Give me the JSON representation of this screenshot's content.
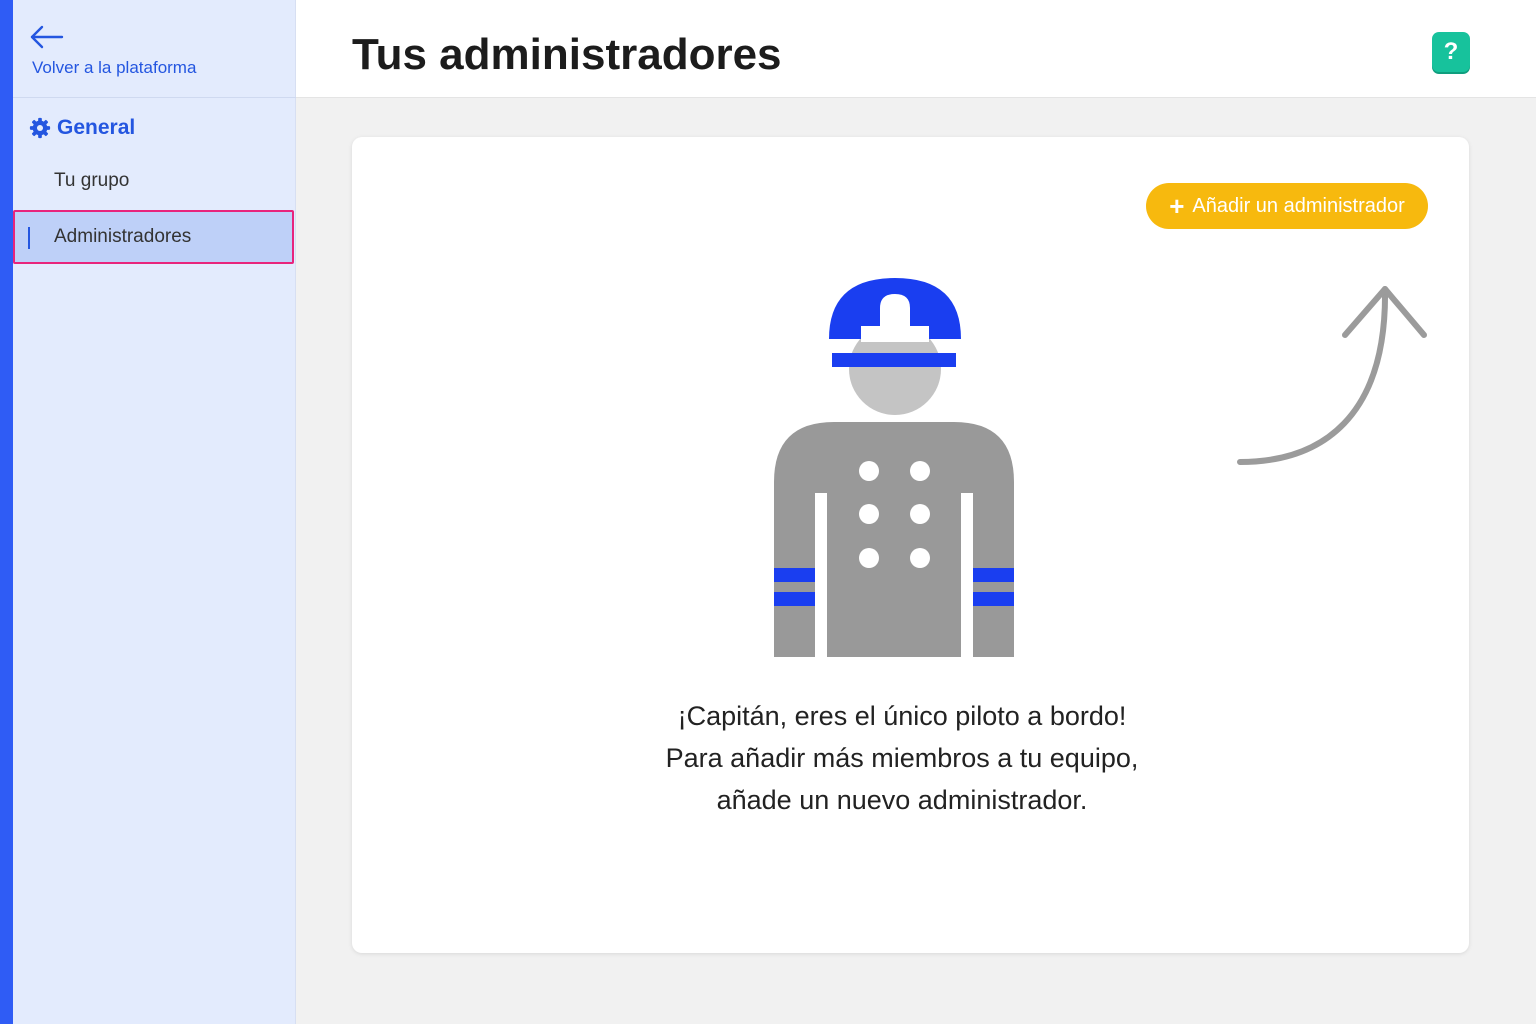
{
  "sidebar": {
    "back_label": "Volver a la plataforma",
    "section_title": "General",
    "items": [
      {
        "label": "Tu grupo",
        "active": false
      },
      {
        "label": "Administradores",
        "active": true
      }
    ]
  },
  "header": {
    "title": "Tus administradores",
    "help_label": "?"
  },
  "main": {
    "add_button": {
      "icon": "+",
      "label": "Añadir un administrador"
    },
    "message_lines": [
      "¡Capitán, eres el único piloto a bordo!",
      "Para añadir más miembros a tu equipo,",
      "añade un nuevo administrador."
    ]
  },
  "colors": {
    "accent": "#2456e0",
    "sidebar_bg": "#e3ebfd",
    "active_item_bg": "#bed0f8",
    "highlight_border": "#e8247c",
    "add_button": "#f7b90e",
    "help_button": "#17c29c",
    "captain_blue": "#1a3ef0",
    "captain_gray": "#999999"
  }
}
